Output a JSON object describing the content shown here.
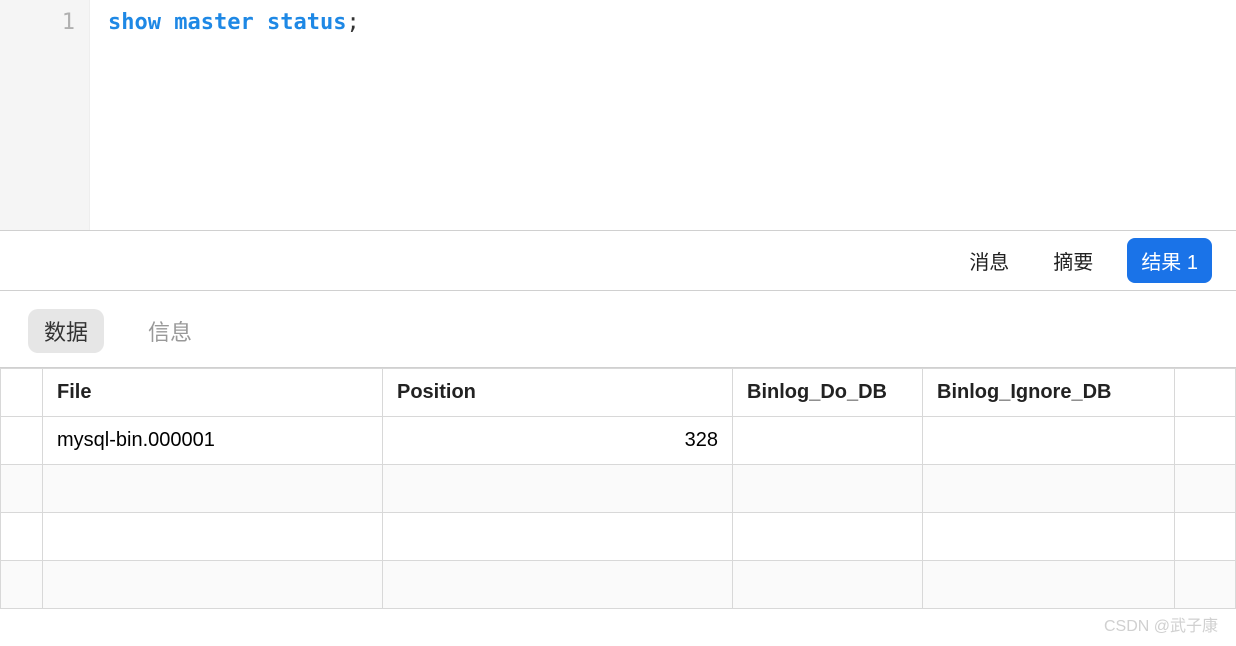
{
  "editor": {
    "line_number": "1",
    "code_tokens": {
      "kw1": "show",
      "kw2": "master",
      "kw3": "status",
      "punct": ";"
    }
  },
  "result_tabs": {
    "messages": "消息",
    "summary": "摘要",
    "result1": "结果 1"
  },
  "sub_tabs": {
    "data": "数据",
    "info": "信息"
  },
  "table": {
    "headers": {
      "file": "File",
      "position": "Position",
      "binlog_do_db": "Binlog_Do_DB",
      "binlog_ignore_db": "Binlog_Ignore_DB"
    },
    "rows": [
      {
        "file": "mysql-bin.000001",
        "position": "328",
        "binlog_do_db": "",
        "binlog_ignore_db": ""
      }
    ]
  },
  "watermark": "CSDN @武子康"
}
